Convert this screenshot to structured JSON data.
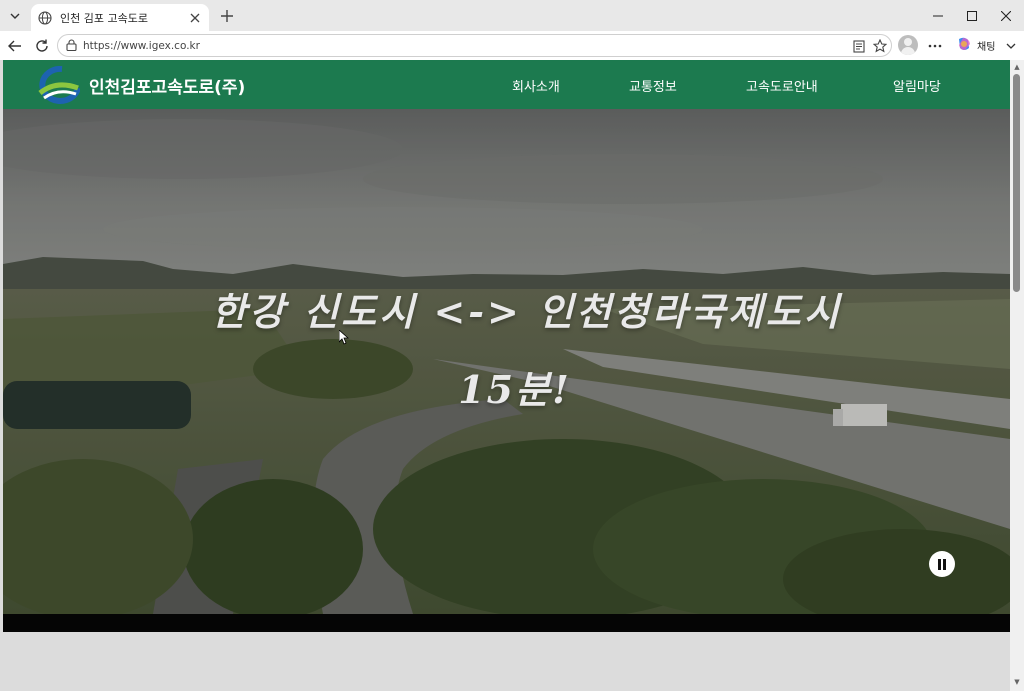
{
  "browser": {
    "tab_title": "인천 김포 고속도로",
    "url": "https://www.igex.co.kr",
    "copilot_label": "채팅"
  },
  "site": {
    "brand": "인천김포고속도로(주)",
    "nav": [
      "회사소개",
      "교통정보",
      "고속도로안내",
      "알림마당"
    ],
    "hero_line1": "한강 신도시 <-> 인천청라국제도시",
    "hero_line2": "15분!"
  },
  "colors": {
    "header_green": "#1c7a4f",
    "logo_blue": "#1d63b0",
    "logo_green": "#8cc63f"
  },
  "icons": [
    "tab-list-icon",
    "globe-icon",
    "close-icon",
    "plus-icon",
    "minimize-icon",
    "maximize-icon",
    "back-icon",
    "reload-icon",
    "lock-icon",
    "reading-mode-icon",
    "favorite-star-icon",
    "profile-icon",
    "more-icon",
    "copilot-icon",
    "chevron-down-icon",
    "pause-icon"
  ]
}
